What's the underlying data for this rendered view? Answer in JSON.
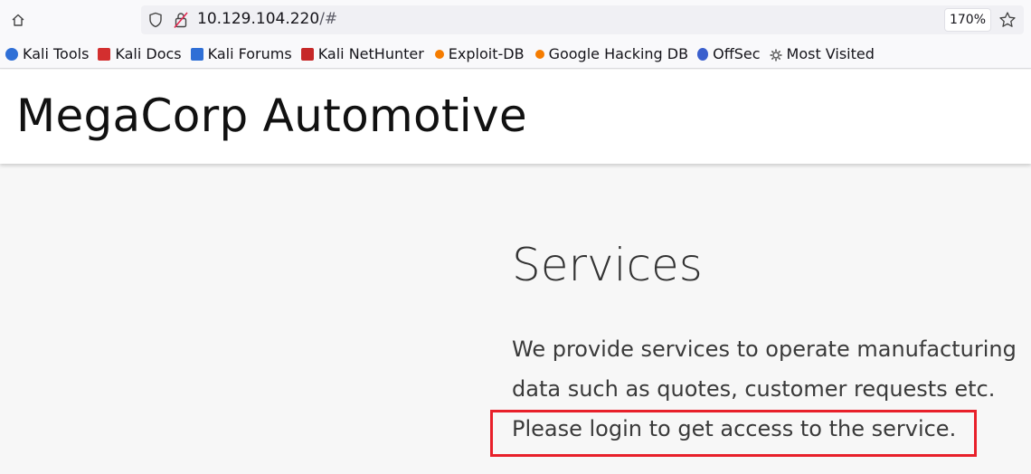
{
  "browser": {
    "url_host": "10.129.104.220",
    "url_path": "/#",
    "zoom": "170%"
  },
  "bookmarks": [
    {
      "label": "Kali Tools",
      "icon": "kali-tools-icon",
      "color": "#2f6fd6"
    },
    {
      "label": "Kali Docs",
      "icon": "kali-docs-icon",
      "color": "#d32f2f"
    },
    {
      "label": "Kali Forums",
      "icon": "kali-forums-icon",
      "color": "#2f6fd6"
    },
    {
      "label": "Kali NetHunter",
      "icon": "kali-nethunter-icon",
      "color": "#c62828"
    },
    {
      "label": "Exploit-DB",
      "icon": "exploit-db-icon",
      "color": "#f57c00"
    },
    {
      "label": "Google Hacking DB",
      "icon": "ghdb-icon",
      "color": "#f57c00"
    },
    {
      "label": "OffSec",
      "icon": "offsec-icon",
      "color": "#3a5fcd"
    },
    {
      "label": "Most Visited",
      "icon": "gear-icon",
      "color": "#555555"
    }
  ],
  "header": {
    "title": "MegaCorp Automotive"
  },
  "services": {
    "heading": "Services",
    "lines": [
      "We provide services to operate manufacturing",
      "data such as quotes, customer requests etc.",
      "Please login to get access to the service."
    ]
  },
  "colors": {
    "highlight": "#e8202a"
  }
}
